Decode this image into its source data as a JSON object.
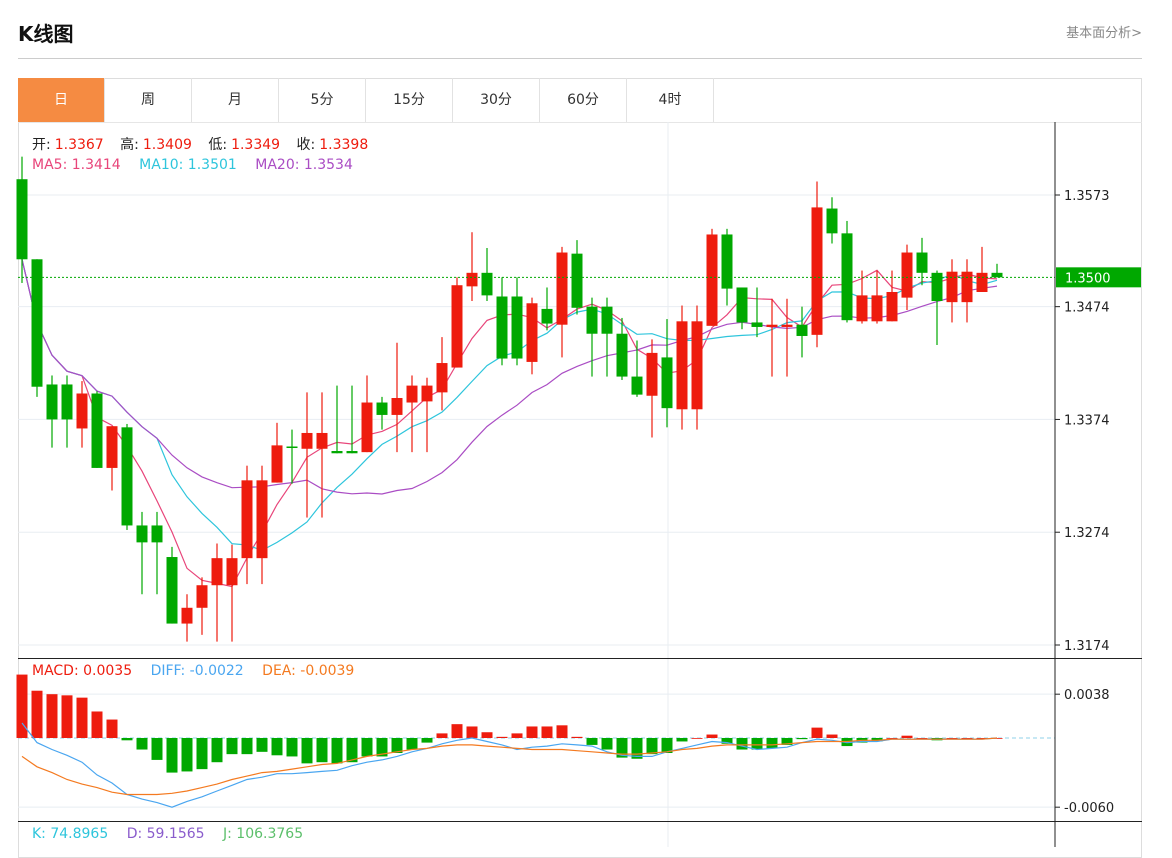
{
  "header": {
    "title": "K线图",
    "link": "基本面分析>"
  },
  "tabs": [
    {
      "label": "日",
      "active": true
    },
    {
      "label": "周"
    },
    {
      "label": "月"
    },
    {
      "label": "5分"
    },
    {
      "label": "15分"
    },
    {
      "label": "30分"
    },
    {
      "label": "60分"
    },
    {
      "label": "4时"
    }
  ],
  "ohlc_info": {
    "open_label": "开:",
    "open": "1.3367",
    "high_label": "高:",
    "high": "1.3409",
    "low_label": "低:",
    "low": "1.3349",
    "close_label": "收:",
    "close": "1.3398"
  },
  "ma_info": {
    "ma5": "MA5: 1.3414",
    "ma10": "MA10: 1.3501",
    "ma20": "MA20: 1.3534"
  },
  "macd_info": {
    "macd": "MACD: 0.0035",
    "diff": "DIFF: -0.0022",
    "dea": "DEA: -0.0039"
  },
  "kdj_info": {
    "k": "K: 74.8965",
    "d": "D: 59.1565",
    "j": "J: 106.3765"
  },
  "colors": {
    "up": "#ee1c0e",
    "down": "#00a800",
    "ma5": "#e8457a",
    "ma10": "#2ec5dc",
    "ma20": "#aa4dc4",
    "diff": "#4aa6f0",
    "dea": "#f47a20",
    "accent": "#f58b42"
  },
  "chart_data": [
    {
      "type": "candlestick",
      "title": "K线图",
      "current_price": "1.3500",
      "y_ticks": [
        "1.3573",
        "1.3474",
        "1.3374",
        "1.3274",
        "1.3174"
      ],
      "ylim": [
        1.3174,
        1.3573
      ],
      "columns": [
        "open",
        "close",
        "high",
        "low"
      ],
      "candles": [
        [
          1.3587,
          1.3516,
          1.3607,
          1.3495
        ],
        [
          1.3516,
          1.3403,
          1.3516,
          1.3394
        ],
        [
          1.3405,
          1.3374,
          1.3413,
          1.3349
        ],
        [
          1.3405,
          1.3374,
          1.3413,
          1.3349
        ],
        [
          1.3366,
          1.3397,
          1.3408,
          1.3349
        ],
        [
          1.3397,
          1.3331,
          1.3399,
          1.3331
        ],
        [
          1.3331,
          1.3368,
          1.3368,
          1.3311
        ],
        [
          1.3367,
          1.328,
          1.337,
          1.3276
        ],
        [
          1.328,
          1.3265,
          1.3292,
          1.3219
        ],
        [
          1.328,
          1.3265,
          1.3292,
          1.3219
        ],
        [
          1.3252,
          1.3193,
          1.3261,
          1.3193
        ],
        [
          1.3193,
          1.3207,
          1.3219,
          1.3177
        ],
        [
          1.3207,
          1.3227,
          1.3234,
          1.3183
        ],
        [
          1.3227,
          1.3251,
          1.3264,
          1.3177
        ],
        [
          1.3227,
          1.3251,
          1.3263,
          1.3177
        ],
        [
          1.3251,
          1.332,
          1.3333,
          1.3228
        ],
        [
          1.3251,
          1.332,
          1.3333,
          1.3228
        ],
        [
          1.3318,
          1.3351,
          1.3371,
          1.3318
        ],
        [
          1.335,
          1.3349,
          1.3365,
          1.3317
        ],
        [
          1.3348,
          1.3362,
          1.3398,
          1.3287
        ],
        [
          1.3348,
          1.3362,
          1.3398,
          1.3287
        ],
        [
          1.3346,
          1.3344,
          1.3404,
          1.3344
        ],
        [
          1.3346,
          1.3344,
          1.3404,
          1.3344
        ],
        [
          1.3345,
          1.3389,
          1.3413,
          1.3345
        ],
        [
          1.3389,
          1.3378,
          1.3394,
          1.3365
        ],
        [
          1.3378,
          1.3393,
          1.3442,
          1.3345
        ],
        [
          1.3389,
          1.3404,
          1.3413,
          1.3345
        ],
        [
          1.339,
          1.3404,
          1.3411,
          1.3345
        ],
        [
          1.3398,
          1.3424,
          1.3447,
          1.3382
        ],
        [
          1.342,
          1.3493,
          1.35,
          1.342
        ],
        [
          1.3492,
          1.3504,
          1.354,
          1.3479
        ],
        [
          1.3504,
          1.3484,
          1.3526,
          1.3479
        ],
        [
          1.3483,
          1.3428,
          1.35,
          1.3422
        ],
        [
          1.3483,
          1.3428,
          1.35,
          1.3422
        ],
        [
          1.3425,
          1.3477,
          1.3482,
          1.3414
        ],
        [
          1.3472,
          1.3459,
          1.3491,
          1.3453
        ],
        [
          1.3458,
          1.3522,
          1.3527,
          1.3429
        ],
        [
          1.3521,
          1.3473,
          1.3533,
          1.3467
        ],
        [
          1.3474,
          1.345,
          1.3482,
          1.3412
        ],
        [
          1.3474,
          1.345,
          1.3482,
          1.3412
        ],
        [
          1.345,
          1.3412,
          1.3464,
          1.3409
        ],
        [
          1.3412,
          1.3396,
          1.3444,
          1.3394
        ],
        [
          1.3395,
          1.3433,
          1.3445,
          1.3358
        ],
        [
          1.3429,
          1.3384,
          1.3463,
          1.3367
        ],
        [
          1.3383,
          1.3461,
          1.3475,
          1.3365
        ],
        [
          1.3383,
          1.3461,
          1.3475,
          1.3365
        ],
        [
          1.3457,
          1.3538,
          1.3543,
          1.3457
        ],
        [
          1.3538,
          1.349,
          1.3543,
          1.3475
        ],
        [
          1.3491,
          1.346,
          1.3491,
          1.3454
        ],
        [
          1.346,
          1.3456,
          1.3491,
          1.3447
        ],
        [
          1.3456,
          1.3458,
          1.3481,
          1.3412
        ],
        [
          1.3456,
          1.3458,
          1.3481,
          1.3412
        ],
        [
          1.3458,
          1.3448,
          1.3474,
          1.3429
        ],
        [
          1.3449,
          1.3562,
          1.3585,
          1.3438
        ],
        [
          1.3561,
          1.3539,
          1.3571,
          1.353
        ],
        [
          1.3539,
          1.3462,
          1.355,
          1.346
        ],
        [
          1.3461,
          1.3484,
          1.3506,
          1.3459
        ],
        [
          1.3461,
          1.3484,
          1.3506,
          1.3459
        ],
        [
          1.3461,
          1.3487,
          1.3506,
          1.3461
        ],
        [
          1.3482,
          1.3522,
          1.3529,
          1.3471
        ],
        [
          1.3522,
          1.3504,
          1.3535,
          1.3493
        ],
        [
          1.3504,
          1.3479,
          1.3506,
          1.344
        ],
        [
          1.3478,
          1.3505,
          1.3516,
          1.346
        ],
        [
          1.3478,
          1.3505,
          1.3516,
          1.346
        ],
        [
          1.3487,
          1.3504,
          1.3527,
          1.3487
        ],
        [
          1.3504,
          1.35,
          1.3512,
          1.35
        ]
      ],
      "moving_averages": [
        "MA5",
        "MA10",
        "MA20"
      ]
    },
    {
      "type": "bar+line",
      "title": "MACD",
      "y_ticks": [
        "0.0038",
        "-0.0060"
      ],
      "ylim": [
        -0.006,
        0.0038
      ],
      "macd": [
        0.0055,
        0.0041,
        0.0038,
        0.0037,
        0.0035,
        0.0023,
        0.0016,
        -0.0002,
        -0.001,
        -0.0019,
        -0.003,
        -0.0029,
        -0.0027,
        -0.0021,
        -0.0014,
        -0.0014,
        -0.0012,
        -0.0015,
        -0.0016,
        -0.0022,
        -0.0021,
        -0.0022,
        -0.0021,
        -0.0016,
        -0.0016,
        -0.0013,
        -0.001,
        -0.0004,
        0.0004,
        0.0012,
        0.001,
        0.0005,
        0.0001,
        0.0004,
        0.001,
        0.001,
        0.0011,
        0.0001,
        -0.0006,
        -0.001,
        -0.0017,
        -0.0018,
        -0.0014,
        -0.0013,
        -0.0003,
        0.0,
        0.0003,
        -0.0005,
        -0.001,
        -0.001,
        -0.0009,
        -0.0006,
        -0.0001,
        0.0009,
        0.0003,
        -0.0007,
        -0.0004,
        -0.0003,
        0.0,
        0.0002,
        0.0,
        -0.0002,
        0.0,
        0.0,
        0.0,
        0.0
      ],
      "diff": [
        0.0013,
        -0.0004,
        -0.001,
        -0.0015,
        -0.0021,
        -0.0032,
        -0.0039,
        -0.0049,
        -0.0053,
        -0.0056,
        -0.006,
        -0.0055,
        -0.0051,
        -0.0046,
        -0.0041,
        -0.0036,
        -0.0034,
        -0.0031,
        -0.0031,
        -0.003,
        -0.0029,
        -0.0028,
        -0.0024,
        -0.0021,
        -0.0019,
        -0.0016,
        -0.0012,
        -0.0009,
        -0.0005,
        -0.0002,
        0.0,
        -0.0003,
        -0.0006,
        -0.001,
        -0.0008,
        -0.0007,
        -0.0005,
        -0.0006,
        -0.0007,
        -0.0012,
        -0.0015,
        -0.0016,
        -0.0016,
        -0.0012,
        -0.0009,
        -0.0006,
        -0.0003,
        -0.0004,
        -0.0007,
        -0.001,
        -0.0009,
        -0.0008,
        -0.0004,
        -0.0001,
        -0.0002,
        -0.0004,
        -0.0003,
        -0.0003,
        -0.0001,
        -0.0001,
        -0.0001,
        -0.0001,
        -0.0001,
        -0.0001,
        -0.0001,
        0.0
      ],
      "dea": [
        -0.0016,
        -0.0025,
        -0.003,
        -0.0036,
        -0.004,
        -0.0043,
        -0.0047,
        -0.0049,
        -0.0049,
        -0.0049,
        -0.0048,
        -0.0046,
        -0.0043,
        -0.004,
        -0.0036,
        -0.0033,
        -0.003,
        -0.0029,
        -0.0027,
        -0.0025,
        -0.0023,
        -0.0022,
        -0.0019,
        -0.0016,
        -0.0014,
        -0.0012,
        -0.001,
        -0.0009,
        -0.0007,
        -0.0006,
        -0.0006,
        -0.0007,
        -0.0008,
        -0.0009,
        -0.001,
        -0.001,
        -0.001,
        -0.0011,
        -0.0012,
        -0.0013,
        -0.0014,
        -0.0014,
        -0.0013,
        -0.0012,
        -0.001,
        -0.0009,
        -0.0007,
        -0.0006,
        -0.0006,
        -0.0006,
        -0.0006,
        -0.0005,
        -0.0004,
        -0.0003,
        -0.0003,
        -0.0003,
        -0.0002,
        -0.0002,
        -0.0001,
        -0.0001,
        -0.0001,
        -0.0001,
        -0.0001,
        -0.0001,
        -0.0001,
        0.0
      ]
    }
  ]
}
